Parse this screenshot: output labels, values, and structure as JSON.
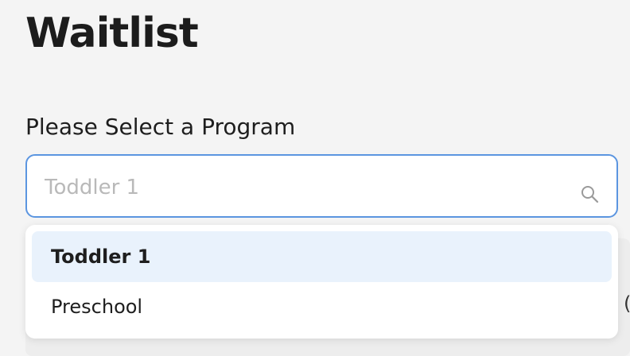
{
  "page": {
    "title": "Waitlist"
  },
  "program_select": {
    "label": "Please Select a Program",
    "placeholder": "Toddler 1",
    "value": "",
    "icon": "search-icon",
    "accent_color": "#5b95e0"
  },
  "dropdown": {
    "options": [
      {
        "label": "Toddler 1",
        "selected": true
      },
      {
        "label": "Preschool",
        "selected": false
      }
    ],
    "highlight_color": "#e9f2fc"
  },
  "background": {
    "edge_glyph": "("
  }
}
